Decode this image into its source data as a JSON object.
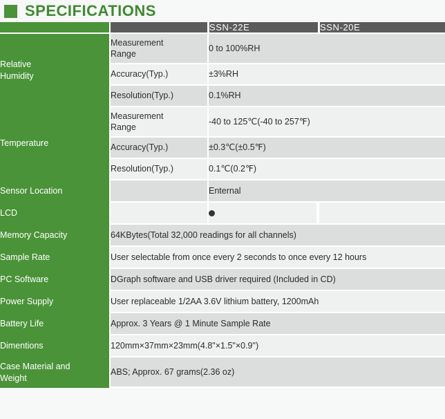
{
  "page": {
    "title": "SPECIFICATIONS",
    "accent_green": "#4a9338",
    "title_green": "#3f8a30",
    "header_gray": "#5b5b5b",
    "row_dark": "#dcdedd",
    "row_light": "#eff1f0"
  },
  "table": {
    "header": {
      "col_label": "",
      "col_sub": "",
      "model_1": "SSN-22E",
      "model_2": "SSN-20E"
    },
    "groups": [
      {
        "label": "Relative\nHumidity",
        "label_line1": "Relative",
        "label_line2": "Humidity",
        "rows": [
          {
            "sub": "Measurement Range",
            "sub_line1": "Measurement",
            "sub_line2": "Range",
            "value": "0 to 100%RH"
          },
          {
            "sub": "Accuracy(Typ.)",
            "value": "±3%RH"
          },
          {
            "sub": "Resolution(Typ.)",
            "value": "0.1%RH"
          }
        ]
      },
      {
        "label": "Temperature",
        "rows": [
          {
            "sub": "Measurement Range",
            "sub_line1": "Measurement",
            "sub_line2": "Range",
            "value": "-40 to 125℃(-40 to 257℉)"
          },
          {
            "sub": "Accuracy(Typ.)",
            "value": "±0.3℃(±0.5℉)"
          },
          {
            "sub": "Resolution(Typ.)",
            "value": "0.1℃(0.2℉)"
          }
        ]
      }
    ],
    "sensor_location": {
      "label": "Sensor Location",
      "sub": "",
      "value": "Enternal"
    },
    "lcd": {
      "label": "LCD",
      "sub": "",
      "mark": "●",
      "mark_column": "SSN-22E"
    },
    "simple_rows": [
      {
        "label": "Memory Capacity",
        "value": "64KBytes(Total 32,000 readings for all channels)"
      },
      {
        "label": "Sample Rate",
        "value": "User selectable from once every 2 seconds to once every 12 hours"
      },
      {
        "label": "PC Software",
        "value": "DGraph software and USB driver required (Included in CD)"
      },
      {
        "label": "Power Supply",
        "value": "User replaceable 1/2AA 3.6V lithium battery, 1200mAh"
      },
      {
        "label": "Battery Life",
        "value": "Approx. 3 Years @ 1 Minute Sample Rate"
      },
      {
        "label": "Dimentions",
        "value": "120mm×37mm×23mm(4.8\"×1.5\"×0.9\")"
      },
      {
        "label": "Case Material and Weight",
        "label_line1": "Case Material and",
        "label_line2": "Weight",
        "value": "ABS; Approx. 67 grams(2.36 oz)"
      }
    ]
  }
}
